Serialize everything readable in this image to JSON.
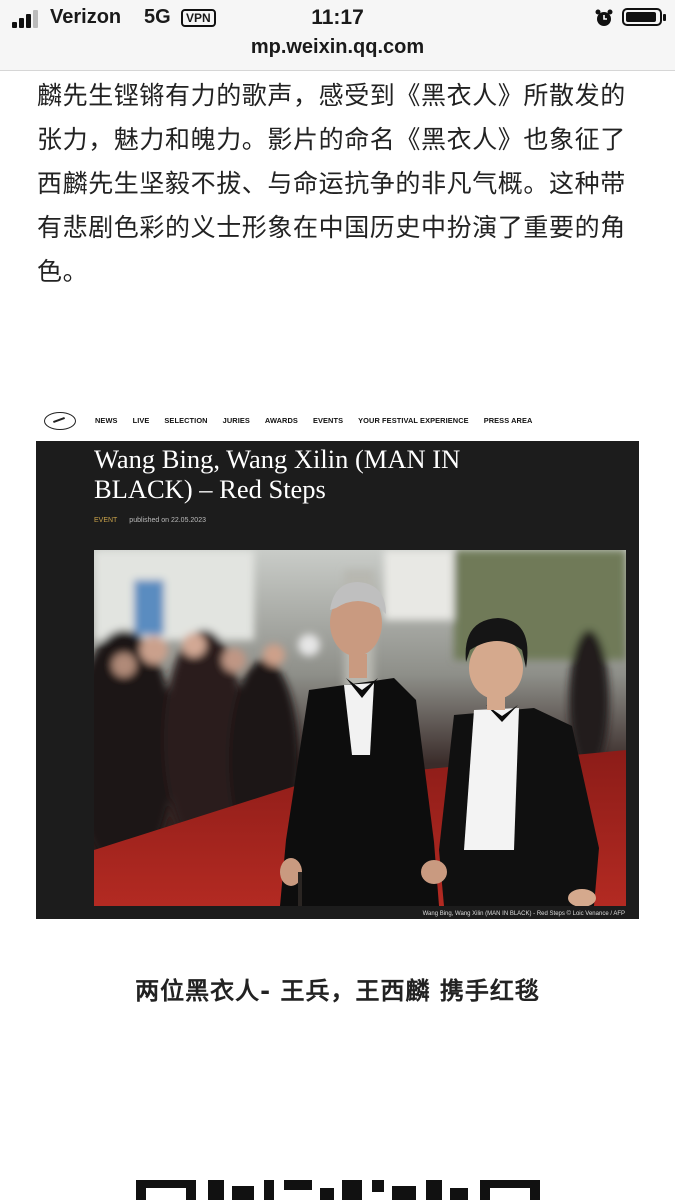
{
  "status": {
    "carrier": "Verizon",
    "network": "5G",
    "vpn": "VPN",
    "time": "11:17",
    "url": "mp.weixin.qq.com"
  },
  "article": {
    "paragraph": "麟先生铿锵有力的歌声，感受到《黑衣人》所散发的张力，魅力和魄力。影片的命名《黑衣人》也象征了西麟先生坚毅不拔、与命运抗争的非凡气概。这种带有悲剧色彩的义士形象在中国历史中扮演了重要的角色。",
    "caption": "两位黑衣人- 王兵，王西麟 携手红毯"
  },
  "embed": {
    "nav": [
      "NEWS",
      "LIVE",
      "SELECTION",
      "JURIES",
      "AWARDS",
      "EVENTS",
      "YOUR FESTIVAL EXPERIENCE",
      "PRESS AREA"
    ],
    "title": "Wang Bing, Wang Xilin (MAN IN BLACK) – Red Steps",
    "tag": "EVENT",
    "published": "published on 22.05.2023",
    "credit": "Wang Bing, Wang Xilin (MAN IN BLACK) - Red Steps © Loic Venance / AFP"
  },
  "colors": {
    "carpet": "#a3201c",
    "embed_bg": "#1c1c1c",
    "event_tag": "#c9a24a"
  }
}
